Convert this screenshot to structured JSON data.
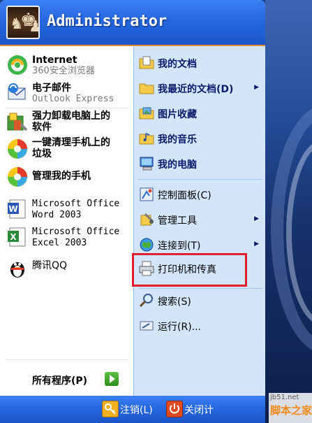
{
  "user": {
    "name": "Administrator"
  },
  "pinned": [
    {
      "title": "Internet",
      "subtitle": "360安全浏览器",
      "icon": "browser-360-icon"
    },
    {
      "title": "电子邮件",
      "subtitle": "Outlook Express",
      "icon": "outlook-express-icon"
    }
  ],
  "recent": [
    {
      "line1": "强力卸载电脑上的",
      "line2": "软件",
      "icon": "uninstaller-icon"
    },
    {
      "line1": "一键清理手机上的",
      "line2": "垃圾",
      "icon": "phone-cleaner-icon"
    },
    {
      "line1": "管理我的手机",
      "line2": "",
      "icon": "phone-manager-icon"
    },
    {
      "line1": "Microsoft Office",
      "line2": "Word 2003",
      "icon": "word-icon"
    },
    {
      "line1": "Microsoft Office",
      "line2": "Excel 2003",
      "icon": "excel-icon"
    },
    {
      "line1": "腾讯QQ",
      "line2": "",
      "icon": "qq-penguin-icon"
    }
  ],
  "all_programs": {
    "label": "所有程序(P)"
  },
  "places": [
    {
      "label": "我的文档",
      "icon": "my-documents-icon",
      "submenu": false,
      "bold": true
    },
    {
      "label": "我最近的文档(D)",
      "icon": "recent-documents-icon",
      "submenu": true,
      "bold": true
    },
    {
      "label": "图片收藏",
      "icon": "my-pictures-icon",
      "submenu": false,
      "bold": true
    },
    {
      "label": "我的音乐",
      "icon": "my-music-icon",
      "submenu": false,
      "bold": true
    },
    {
      "label": "我的电脑",
      "icon": "my-computer-icon",
      "submenu": false,
      "bold": true
    }
  ],
  "system": [
    {
      "label": "控制面板(C)",
      "icon": "control-panel-icon",
      "submenu": false
    },
    {
      "label": "管理工具",
      "icon": "admin-tools-icon",
      "submenu": true
    },
    {
      "label": "连接到(T)",
      "icon": "connect-to-icon",
      "submenu": true
    }
  ],
  "printers": {
    "label": "打印机和传真",
    "icon": "printer-icon"
  },
  "tools": [
    {
      "label": "搜索(S)",
      "icon": "search-icon"
    },
    {
      "label": "运行(R)...",
      "icon": "run-icon"
    }
  ],
  "footer": {
    "logoff": "注销(L)",
    "shutdown": "关闭计"
  },
  "watermark": {
    "top": "jb51.net",
    "main": "脚本之家"
  },
  "colors": {
    "header": "#2768e0",
    "right_pane": "#d3e5fa",
    "highlight": "#e0202f"
  }
}
